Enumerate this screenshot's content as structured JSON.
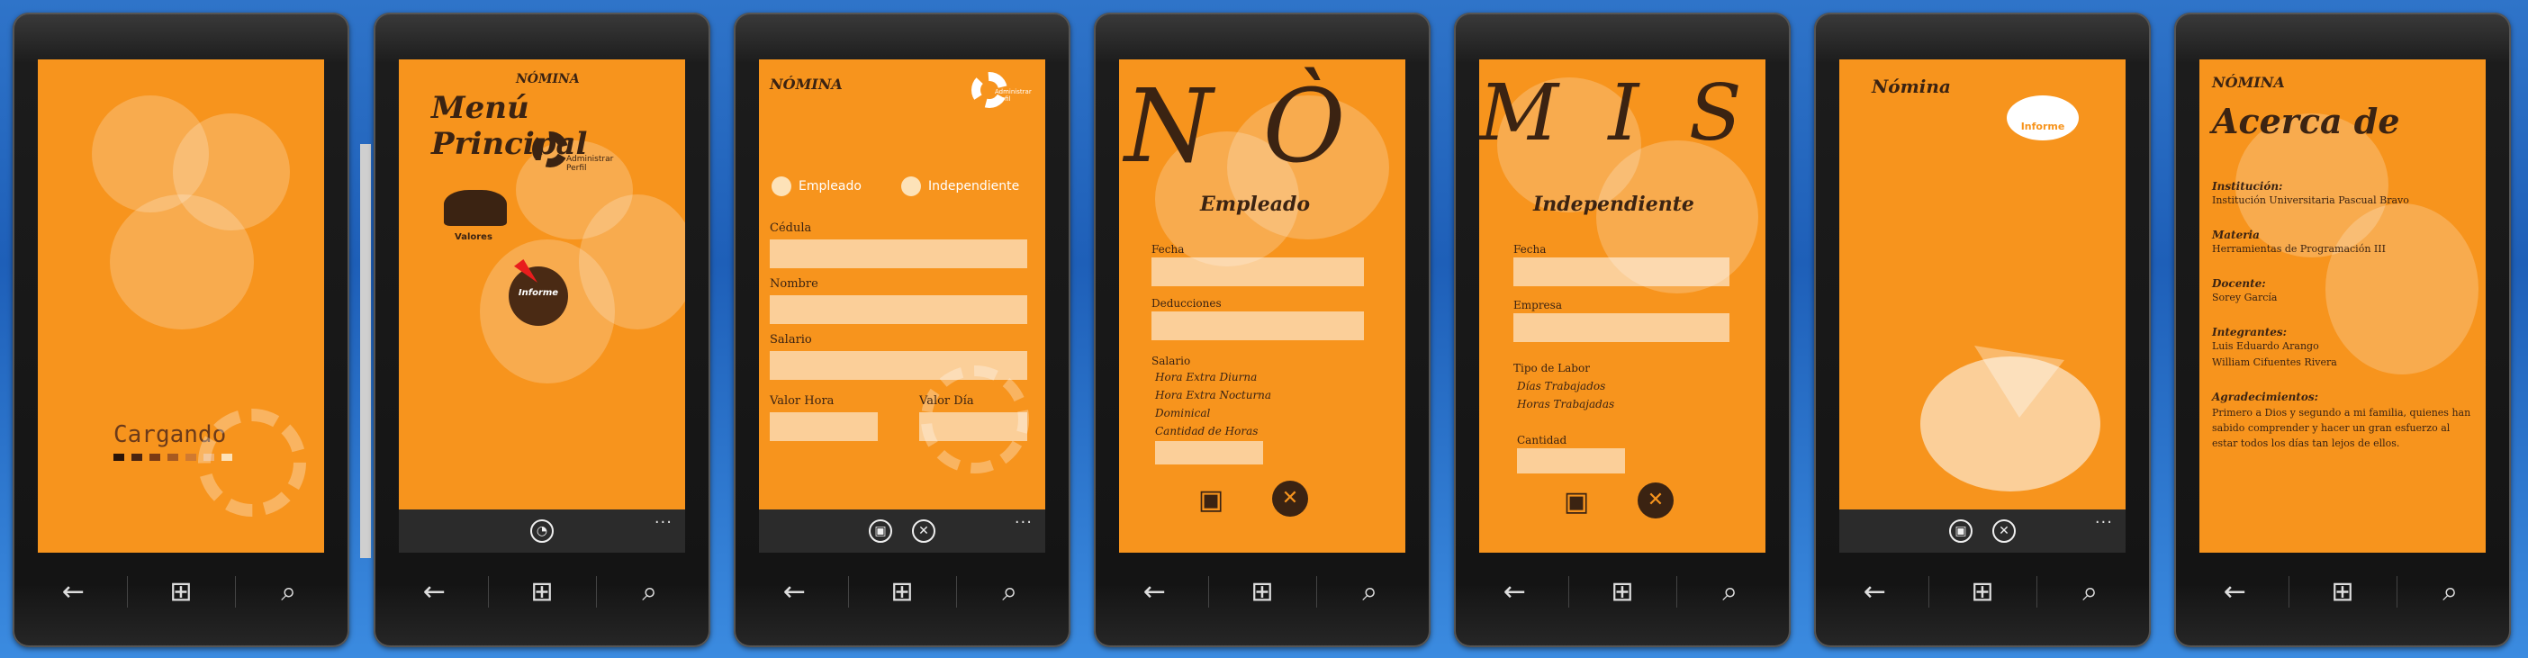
{
  "hw": {
    "back": "←",
    "start": "⊞",
    "search": "⌕"
  },
  "p1": {
    "loading": "Cargando"
  },
  "p2": {
    "nomina": "NÓMINA",
    "title": "Menú Principal",
    "admin": "Administrar Perfil",
    "valores": "Valores",
    "informe": "Informe"
  },
  "p3": {
    "nomina": "NÓMINA",
    "admin": "Administrar Perfil",
    "empleado": "Empleado",
    "independiente": "Independiente",
    "cedula": "Cédula",
    "nombre": "Nombre",
    "salario": "Salario",
    "valor_hora": "Valor Hora",
    "valor_dia": "Valor Día"
  },
  "p4": {
    "big": "N Ò",
    "title": "Empleado",
    "fecha": "Fecha",
    "deducciones": "Deducciones",
    "salario": "Salario",
    "items": [
      "Hora Extra Diurna",
      "Hora Extra Nocturna",
      "Dominical",
      "Cantidad de Horas"
    ]
  },
  "p5": {
    "big": "M I S",
    "title": "Independiente",
    "fecha": "Fecha",
    "empresa": "Empresa",
    "tipo": "Tipo de Labor",
    "items": [
      "Días Trabajados",
      "Horas Trabajadas"
    ],
    "cantidad": "Cantidad"
  },
  "p6": {
    "nomina": "Nómina",
    "informe": "Informe"
  },
  "p7": {
    "nomina": "NÓMINA",
    "title": "Acerca de",
    "inst_l": "Institución:",
    "inst_v": "Institución Universitaria Pascual Bravo",
    "mat_l": "Materia",
    "mat_v": "Herramientas de Programación III",
    "doc_l": "Docente:",
    "doc_v": "Sorey García",
    "int_l": "Integrantes:",
    "int_v1": "Luis Eduardo Arango",
    "int_v2": "William Cifuentes Rivera",
    "agr_l": "Agradecimientos:",
    "agr_v": "Primero a Dios y segundo a mi familia, quienes han sabido comprender y hacer un gran esfuerzo al estar todos los días tan lejos de ellos."
  },
  "colors": {
    "accent": "#f7941d",
    "text": "#3b2312"
  }
}
